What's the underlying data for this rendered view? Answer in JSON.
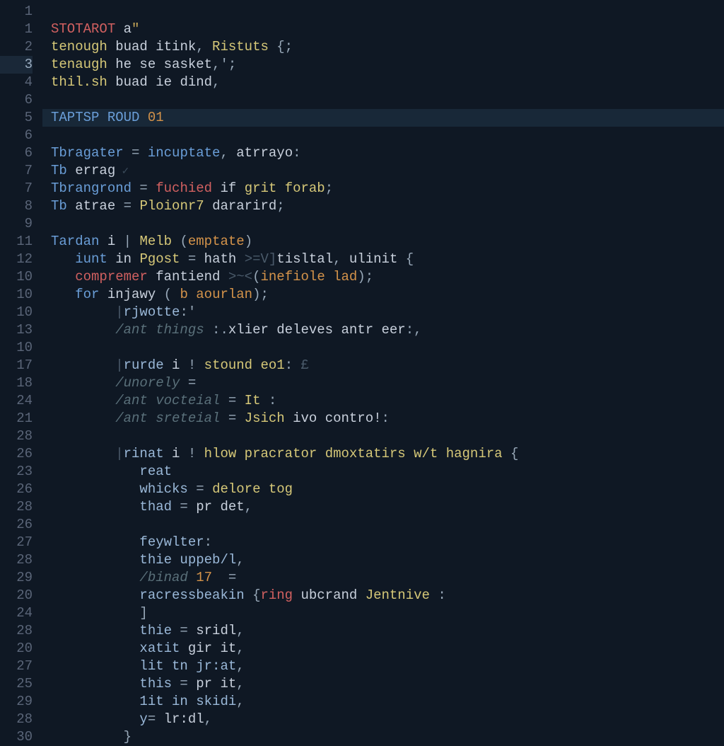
{
  "editor": {
    "highlighted_line_index": 6,
    "active_gutter_index": 3,
    "gutter_numbers": [
      "1",
      "1",
      "2",
      "3",
      "4",
      "6",
      "5",
      "6",
      "6",
      "7",
      "7",
      "8",
      "9",
      "11",
      "12",
      "10",
      "10",
      "10",
      "13",
      "10",
      "17",
      "18",
      "24",
      "21",
      "28",
      "26",
      "23",
      "26",
      "28",
      "26",
      "27",
      "28",
      "29",
      "20",
      "24",
      "28",
      "20",
      "27",
      "25",
      "29",
      "28",
      "30"
    ],
    "lines": [
      {
        "tokens": [
          {
            "t": "",
            "c": "ident"
          }
        ]
      },
      {
        "tokens": [
          {
            "t": "STOTAROT",
            "c": "kw-red"
          },
          {
            "t": " a",
            "c": "ident"
          },
          {
            "t": "\"",
            "c": "str"
          }
        ]
      },
      {
        "tokens": [
          {
            "t": "tenough",
            "c": "kw-yellow"
          },
          {
            "t": " buad itink",
            "c": "ident"
          },
          {
            "t": ",",
            "c": "punct"
          },
          {
            "t": " Ristuts ",
            "c": "type"
          },
          {
            "t": "{;",
            "c": "punct"
          }
        ]
      },
      {
        "tokens": [
          {
            "t": "tenaugh",
            "c": "kw-yellow"
          },
          {
            "t": " he se sasket",
            "c": "ident"
          },
          {
            "t": ",';",
            "c": "punct"
          }
        ]
      },
      {
        "tokens": [
          {
            "t": "thil.sh",
            "c": "kw-yellow"
          },
          {
            "t": " buad ie dind",
            "c": "ident"
          },
          {
            "t": ",",
            "c": "punct"
          }
        ]
      },
      {
        "tokens": []
      },
      {
        "tokens": [
          {
            "t": "TAPTSP ROUD ",
            "c": "kw-blue"
          },
          {
            "t": "01",
            "c": "num"
          }
        ],
        "highlight": true
      },
      {
        "tokens": []
      },
      {
        "tokens": [
          {
            "t": "Tbragater",
            "c": "kw-blue"
          },
          {
            "t": " = ",
            "c": "op"
          },
          {
            "t": "incuptate",
            "c": "fn"
          },
          {
            "t": ",",
            "c": "punct"
          },
          {
            "t": " atrrayo",
            "c": "ident"
          },
          {
            "t": ":",
            "c": "punct"
          }
        ]
      },
      {
        "tokens": [
          {
            "t": "Tb",
            "c": "kw-blue"
          },
          {
            "t": " errag",
            "c": "ident"
          },
          {
            "t": " ✓",
            "c": "hint"
          }
        ]
      },
      {
        "tokens": [
          {
            "t": "Tbrangrond",
            "c": "kw-blue"
          },
          {
            "t": " = ",
            "c": "op"
          },
          {
            "t": "fuchied",
            "c": "kw-red"
          },
          {
            "t": " if ",
            "c": "ident"
          },
          {
            "t": "grit forab",
            "c": "kw-yellow"
          },
          {
            "t": ";",
            "c": "punct"
          }
        ]
      },
      {
        "tokens": [
          {
            "t": "Tb",
            "c": "kw-blue"
          },
          {
            "t": " atrae",
            "c": "ident"
          },
          {
            "t": " = ",
            "c": "op"
          },
          {
            "t": "Ploionr7",
            "c": "type"
          },
          {
            "t": " dararird",
            "c": "ident"
          },
          {
            "t": ";",
            "c": "punct"
          }
        ]
      },
      {
        "tokens": []
      },
      {
        "tokens": [
          {
            "t": "Tardan",
            "c": "kw-blue"
          },
          {
            "t": " i ",
            "c": "ident"
          },
          {
            "t": "|",
            "c": "op"
          },
          {
            "t": " Melb ",
            "c": "type"
          },
          {
            "t": "(",
            "c": "punct"
          },
          {
            "t": "emptate",
            "c": "param"
          },
          {
            "t": ")",
            "c": "punct"
          }
        ]
      },
      {
        "tokens": [
          {
            "t": "   ",
            "c": "ident"
          },
          {
            "t": "iunt",
            "c": "kw-blue"
          },
          {
            "t": " in ",
            "c": "ident"
          },
          {
            "t": "Pgost",
            "c": "type"
          },
          {
            "t": " = ",
            "c": "op"
          },
          {
            "t": "hath ",
            "c": "ident"
          },
          {
            "t": ">=V]",
            "c": "faded"
          },
          {
            "t": "tisltal",
            "c": "ident"
          },
          {
            "t": ",",
            "c": "punct"
          },
          {
            "t": " ulinit ",
            "c": "ident"
          },
          {
            "t": "{",
            "c": "punct"
          }
        ]
      },
      {
        "tokens": [
          {
            "t": "   ",
            "c": "ident"
          },
          {
            "t": "compremer",
            "c": "kw-red"
          },
          {
            "t": " fantiend ",
            "c": "ident"
          },
          {
            "t": ">~<",
            "c": "faded"
          },
          {
            "t": "(",
            "c": "punct"
          },
          {
            "t": "inefiole lad",
            "c": "param"
          },
          {
            "t": ");",
            "c": "punct"
          }
        ]
      },
      {
        "tokens": [
          {
            "t": "   ",
            "c": "ident"
          },
          {
            "t": "for",
            "c": "kw-blue"
          },
          {
            "t": " injawy ",
            "c": "ident"
          },
          {
            "t": "(",
            "c": "punct"
          },
          {
            "t": " b aourlan",
            "c": "param"
          },
          {
            "t": ");",
            "c": "punct"
          }
        ]
      },
      {
        "tokens": [
          {
            "t": "        ",
            "c": "ident"
          },
          {
            "t": "|",
            "c": "faded"
          },
          {
            "t": "rjwotte",
            "c": "prop"
          },
          {
            "t": ":'",
            "c": "punct"
          }
        ]
      },
      {
        "tokens": [
          {
            "t": "        ",
            "c": "ident"
          },
          {
            "t": "/ant things ",
            "c": "comment"
          },
          {
            "t": ":.",
            "c": "punct"
          },
          {
            "t": "xlier deleves antr eer",
            "c": "ident"
          },
          {
            "t": ":,",
            "c": "punct"
          }
        ]
      },
      {
        "tokens": []
      },
      {
        "tokens": [
          {
            "t": "        ",
            "c": "ident"
          },
          {
            "t": "|",
            "c": "faded"
          },
          {
            "t": "rurde",
            "c": "prop"
          },
          {
            "t": " i ",
            "c": "ident"
          },
          {
            "t": "!",
            "c": "op"
          },
          {
            "t": " stound eo1",
            "c": "kw-yellow"
          },
          {
            "t": ": ",
            "c": "punct"
          },
          {
            "t": "£",
            "c": "faded"
          }
        ]
      },
      {
        "tokens": [
          {
            "t": "        ",
            "c": "ident"
          },
          {
            "t": "/unorely",
            "c": "comment"
          },
          {
            "t": " =",
            "c": "op"
          }
        ]
      },
      {
        "tokens": [
          {
            "t": "        ",
            "c": "ident"
          },
          {
            "t": "/ant vocteial",
            "c": "comment"
          },
          {
            "t": " = ",
            "c": "op"
          },
          {
            "t": "It ",
            "c": "type"
          },
          {
            "t": ":",
            "c": "punct"
          }
        ]
      },
      {
        "tokens": [
          {
            "t": "        ",
            "c": "ident"
          },
          {
            "t": "/ant sreteial",
            "c": "comment"
          },
          {
            "t": " = ",
            "c": "op"
          },
          {
            "t": "Jsich",
            "c": "type"
          },
          {
            "t": " ivo contro!",
            "c": "ident"
          },
          {
            "t": ":",
            "c": "punct"
          }
        ]
      },
      {
        "tokens": []
      },
      {
        "tokens": [
          {
            "t": "        ",
            "c": "ident"
          },
          {
            "t": "|",
            "c": "faded"
          },
          {
            "t": "rinat",
            "c": "prop"
          },
          {
            "t": " i ",
            "c": "ident"
          },
          {
            "t": "!",
            "c": "op"
          },
          {
            "t": " hlow pracrator dmoxtatirs w/t hagnira ",
            "c": "kw-yellow"
          },
          {
            "t": "{",
            "c": "punct"
          }
        ]
      },
      {
        "tokens": [
          {
            "t": "           ",
            "c": "ident"
          },
          {
            "t": "reat",
            "c": "prop"
          }
        ]
      },
      {
        "tokens": [
          {
            "t": "           ",
            "c": "ident"
          },
          {
            "t": "whicks",
            "c": "prop"
          },
          {
            "t": " = ",
            "c": "op"
          },
          {
            "t": "delore tog",
            "c": "kw-yellow"
          }
        ]
      },
      {
        "tokens": [
          {
            "t": "           ",
            "c": "ident"
          },
          {
            "t": "thad",
            "c": "prop"
          },
          {
            "t": " = ",
            "c": "op"
          },
          {
            "t": "pr det",
            "c": "ident"
          },
          {
            "t": ",",
            "c": "punct"
          }
        ]
      },
      {
        "tokens": []
      },
      {
        "tokens": [
          {
            "t": "           ",
            "c": "ident"
          },
          {
            "t": "feywlter",
            "c": "prop"
          },
          {
            "t": ":",
            "c": "punct"
          }
        ]
      },
      {
        "tokens": [
          {
            "t": "           ",
            "c": "ident"
          },
          {
            "t": "thie uppeb/l",
            "c": "prop"
          },
          {
            "t": ",",
            "c": "punct"
          }
        ]
      },
      {
        "tokens": [
          {
            "t": "           ",
            "c": "ident"
          },
          {
            "t": "/binad ",
            "c": "comment"
          },
          {
            "t": "17",
            "c": "num"
          },
          {
            "t": "  =",
            "c": "op"
          }
        ]
      },
      {
        "tokens": [
          {
            "t": "           ",
            "c": "ident"
          },
          {
            "t": "racressbeakin ",
            "c": "prop"
          },
          {
            "t": "{",
            "c": "punct"
          },
          {
            "t": "ring",
            "c": "kw-red"
          },
          {
            "t": " ubcrand ",
            "c": "ident"
          },
          {
            "t": "Jentnive ",
            "c": "type"
          },
          {
            "t": ":",
            "c": "punct"
          }
        ]
      },
      {
        "tokens": [
          {
            "t": "           ",
            "c": "ident"
          },
          {
            "t": "]",
            "c": "punct"
          }
        ]
      },
      {
        "tokens": [
          {
            "t": "           ",
            "c": "ident"
          },
          {
            "t": "thie",
            "c": "prop"
          },
          {
            "t": " = ",
            "c": "op"
          },
          {
            "t": "sridl",
            "c": "ident"
          },
          {
            "t": ",",
            "c": "punct"
          }
        ]
      },
      {
        "tokens": [
          {
            "t": "           ",
            "c": "ident"
          },
          {
            "t": "xatit",
            "c": "prop"
          },
          {
            "t": " gir it",
            "c": "ident"
          },
          {
            "t": ",",
            "c": "punct"
          }
        ]
      },
      {
        "tokens": [
          {
            "t": "           ",
            "c": "ident"
          },
          {
            "t": "lit tn jr:at",
            "c": "prop"
          },
          {
            "t": ",",
            "c": "punct"
          }
        ]
      },
      {
        "tokens": [
          {
            "t": "           ",
            "c": "ident"
          },
          {
            "t": "this",
            "c": "prop"
          },
          {
            "t": " = ",
            "c": "op"
          },
          {
            "t": "pr it",
            "c": "ident"
          },
          {
            "t": ",",
            "c": "punct"
          }
        ]
      },
      {
        "tokens": [
          {
            "t": "           ",
            "c": "ident"
          },
          {
            "t": "1it in skidi",
            "c": "prop"
          },
          {
            "t": ",",
            "c": "punct"
          }
        ]
      },
      {
        "tokens": [
          {
            "t": "           ",
            "c": "ident"
          },
          {
            "t": "y",
            "c": "prop"
          },
          {
            "t": "= ",
            "c": "op"
          },
          {
            "t": "lr:dl",
            "c": "ident"
          },
          {
            "t": ",",
            "c": "punct"
          }
        ]
      },
      {
        "tokens": [
          {
            "t": "         ",
            "c": "ident"
          },
          {
            "t": "}",
            "c": "punct"
          }
        ]
      }
    ]
  }
}
